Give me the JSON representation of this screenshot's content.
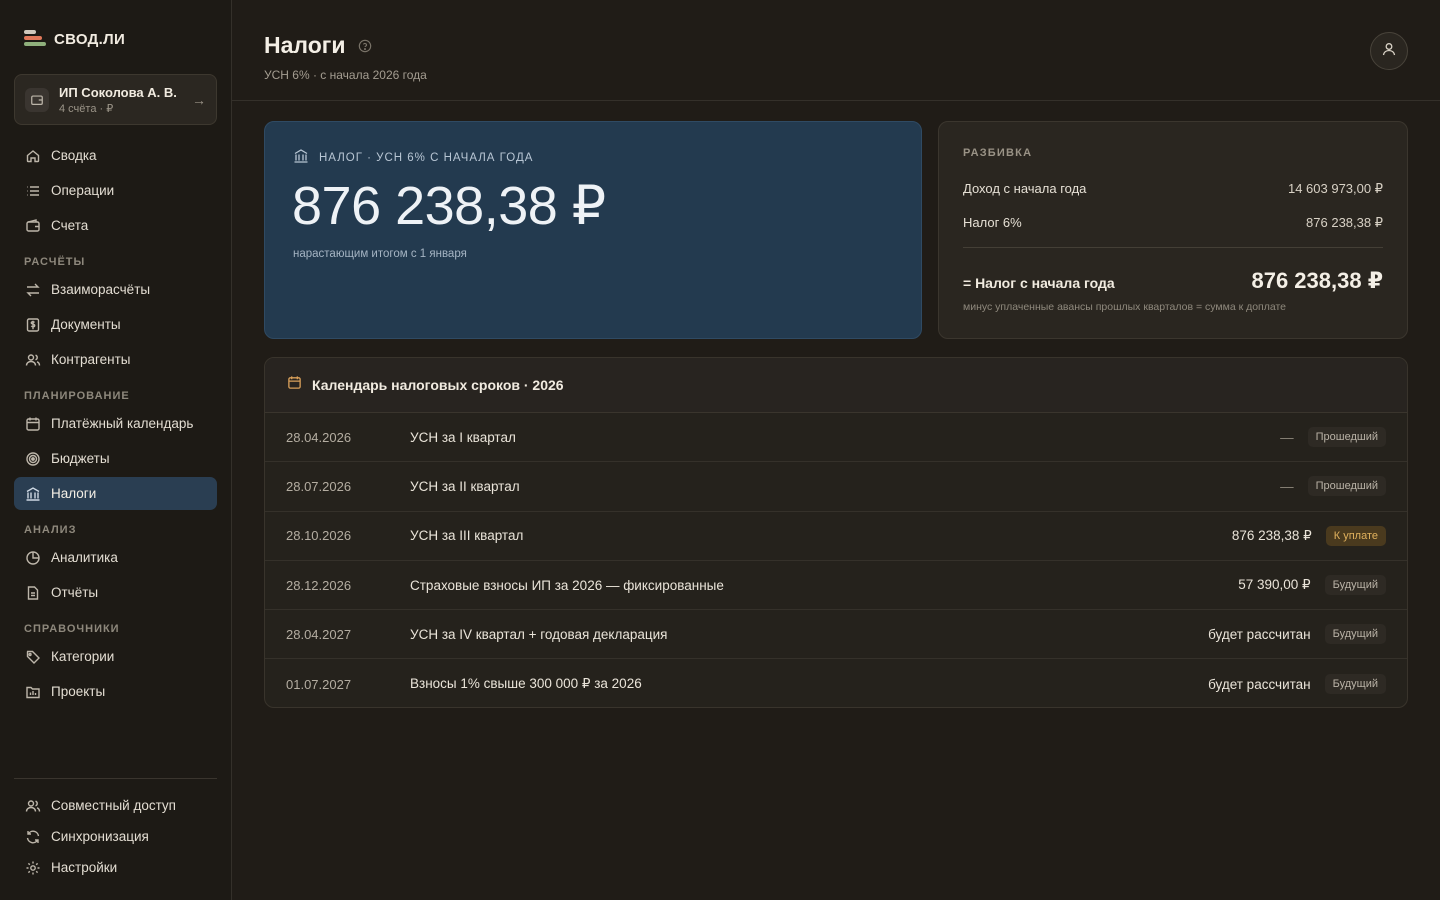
{
  "app": {
    "logo_text": "СВОД.ЛИ"
  },
  "account": {
    "name": "ИП Соколова А. В.",
    "sub": "4 счёта · ₽"
  },
  "nav": {
    "main": [
      {
        "label": "Сводка",
        "icon": "home-icon"
      },
      {
        "label": "Операции",
        "icon": "list-icon"
      },
      {
        "label": "Счета",
        "icon": "wallet-icon"
      }
    ],
    "sections": {
      "settlements": "РАСЧЁТЫ",
      "planning": "ПЛАНИРОВАНИЕ",
      "analysis": "АНАЛИЗ",
      "references": "СПРАВОЧНИКИ"
    },
    "settlements": [
      {
        "label": "Взаиморасчёты",
        "icon": "exchange-icon"
      },
      {
        "label": "Документы",
        "icon": "document-dollar-icon"
      },
      {
        "label": "Контрагенты",
        "icon": "users-icon"
      }
    ],
    "planning": [
      {
        "label": "Платёжный календарь",
        "icon": "calendar-icon"
      },
      {
        "label": "Бюджеты",
        "icon": "target-icon"
      },
      {
        "label": "Налоги",
        "icon": "bank-icon"
      }
    ],
    "analysis": [
      {
        "label": "Аналитика",
        "icon": "pie-chart-icon"
      },
      {
        "label": "Отчёты",
        "icon": "report-icon"
      }
    ],
    "references": [
      {
        "label": "Категории",
        "icon": "tag-icon"
      },
      {
        "label": "Проекты",
        "icon": "folder-chart-icon"
      }
    ],
    "bottom": [
      {
        "label": "Совместный доступ",
        "icon": "users-icon"
      },
      {
        "label": "Синхронизация",
        "icon": "sync-icon"
      },
      {
        "label": "Настройки",
        "icon": "gear-icon"
      }
    ]
  },
  "header": {
    "title": "Налоги",
    "subtitle": "УСН 6% · с начала 2026 года"
  },
  "tax_card": {
    "label": "НАЛОГ · УСН 6% С НАЧАЛА ГОДА",
    "amount": "876 238,38 ₽",
    "note": "нарастающим итогом с 1 января"
  },
  "breakdown": {
    "title": "РАЗБИВКА",
    "income_label": "Доход с начала года",
    "income_value": "14 603 973,00 ₽",
    "tax_label": "Налог 6%",
    "tax_value": "876 238,38 ₽",
    "total_label": "= Налог с начала года",
    "total_value": "876 238,38 ₽",
    "note": "минус уплаченные авансы прошлых кварталов = сумма к доплате"
  },
  "calendar": {
    "title": "Календарь налоговых сроков · 2026",
    "rows": [
      {
        "date": "28.04.2026",
        "name": "УСН за I квартал",
        "amount": "—",
        "status": "Прошедший"
      },
      {
        "date": "28.07.2026",
        "name": "УСН за II квартал",
        "amount": "—",
        "status": "Прошедший"
      },
      {
        "date": "28.10.2026",
        "name": "УСН за III квартал",
        "amount": "876 238,38 ₽",
        "status": "К уплате"
      },
      {
        "date": "28.12.2026",
        "name": "Страховые взносы ИП за 2026 — фиксированные",
        "amount": "57 390,00 ₽",
        "status": "Будущий"
      },
      {
        "date": "28.04.2027",
        "name": "УСН за IV квартал + годовая декларация",
        "amount": "будет рассчитан",
        "status": "Будущий"
      },
      {
        "date": "01.07.2027",
        "name": "Взносы 1% свыше 300 000 ₽ за 2026",
        "amount": "будет рассчитан",
        "status": "Будущий"
      }
    ]
  },
  "colors": {
    "accent_active": "#2a3e52",
    "tax_card_bg": "#233a4f",
    "due_badge": "#e0b15d"
  }
}
